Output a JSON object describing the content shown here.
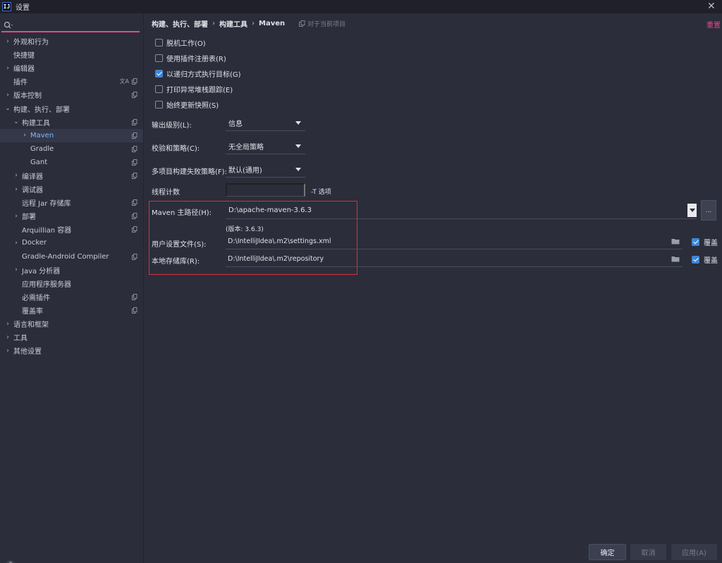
{
  "window": {
    "title": "设置",
    "logo_text": "IJ"
  },
  "search": {
    "value": "",
    "placeholder": ""
  },
  "sidebar": {
    "items": [
      {
        "label": "外观和行为",
        "chevron": "›",
        "indent": 0,
        "copy": false
      },
      {
        "label": "快捷键",
        "chevron": "",
        "indent": 0,
        "copy": false
      },
      {
        "label": "编辑器",
        "chevron": "›",
        "indent": 0,
        "copy": false
      },
      {
        "label": "插件",
        "chevron": "",
        "indent": 0,
        "copy": true,
        "translate": true
      },
      {
        "label": "版本控制",
        "chevron": "›",
        "indent": 0,
        "copy": true
      },
      {
        "label": "构建、执行、部署",
        "chevron": "⌄",
        "indent": 0,
        "copy": false
      },
      {
        "label": "构建工具",
        "chevron": "⌄",
        "indent": 1,
        "copy": true
      },
      {
        "label": "Maven",
        "chevron": "›",
        "indent": 2,
        "copy": true,
        "selected": true
      },
      {
        "label": "Gradle",
        "chevron": "",
        "indent": 2,
        "copy": true
      },
      {
        "label": "Gant",
        "chevron": "",
        "indent": 2,
        "copy": true
      },
      {
        "label": "编译器",
        "chevron": "›",
        "indent": 1,
        "copy": true
      },
      {
        "label": "调试器",
        "chevron": "›",
        "indent": 1,
        "copy": false
      },
      {
        "label": "远程 Jar 存储库",
        "chevron": "",
        "indent": 1,
        "copy": true
      },
      {
        "label": "部署",
        "chevron": "›",
        "indent": 1,
        "copy": true
      },
      {
        "label": "Arquillian 容器",
        "chevron": "",
        "indent": 1,
        "copy": true
      },
      {
        "label": "Docker",
        "chevron": "›",
        "indent": 1,
        "copy": false
      },
      {
        "label": "Gradle-Android Compiler",
        "chevron": "",
        "indent": 1,
        "copy": true
      },
      {
        "label": "Java 分析器",
        "chevron": "›",
        "indent": 1,
        "copy": false
      },
      {
        "label": "应用程序服务器",
        "chevron": "",
        "indent": 1,
        "copy": false
      },
      {
        "label": "必需插件",
        "chevron": "",
        "indent": 1,
        "copy": true
      },
      {
        "label": "覆盖率",
        "chevron": "",
        "indent": 1,
        "copy": true
      },
      {
        "label": "语言和框架",
        "chevron": "›",
        "indent": 0,
        "copy": false
      },
      {
        "label": "工具",
        "chevron": "›",
        "indent": 0,
        "copy": false
      },
      {
        "label": "其他设置",
        "chevron": "›",
        "indent": 0,
        "copy": false
      }
    ],
    "help": "?"
  },
  "breadcrumb": {
    "part1": "构建、执行、部署",
    "part2": "构建工具",
    "part3": "Maven",
    "sep": "›"
  },
  "header": {
    "project_link": "对于当前项目",
    "reset": "重置"
  },
  "checkboxes": [
    {
      "label": "脱机工作(O)",
      "checked": false
    },
    {
      "label": "使用插件注册表(R)",
      "checked": false
    },
    {
      "label": "以递归方式执行目标(G)",
      "checked": true
    },
    {
      "label": "打印异常堆栈跟踪(E)",
      "checked": false
    },
    {
      "label": "始终更新快照(S)",
      "checked": false
    }
  ],
  "fields": {
    "output_level_label": "输出级别(L):",
    "output_level_value": "信息",
    "checksum_label": "校验和策略(C):",
    "checksum_value": "无全局策略",
    "failure_label": "多项目构建失败策略(F):",
    "failure_value": "默认(通用)",
    "thread_label": "线程计数",
    "thread_value": "",
    "thread_suffix": "-T 选项",
    "maven_home_label": "Maven 主路径(H):",
    "maven_home_value": "D:\\apache-maven-3.6.3",
    "browse": "...",
    "version": "(版本: 3.6.3)",
    "user_settings_label": "用户设置文件(S):",
    "user_settings_value": "D:\\IntelliJIdea\\.m2\\settings.xml",
    "local_repo_label": "本地存储库(R):",
    "local_repo_value": "D:\\IntelliJIdea\\.m2\\repository",
    "override_label": "覆盖"
  },
  "buttons": {
    "ok": "确定",
    "cancel": "取消",
    "apply": "应用(A)"
  },
  "colors": {
    "accent": "#e04b8a",
    "checkbox": "#3e86d6",
    "highlight": "#d0343b",
    "selected_text": "#7fb9ff"
  }
}
